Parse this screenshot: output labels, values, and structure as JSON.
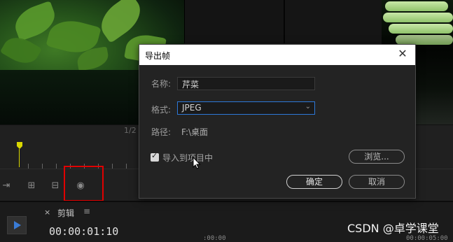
{
  "dialog": {
    "title": "导出帧",
    "name_label": "名称:",
    "name_value": "芹菜",
    "format_label": "格式:",
    "format_value": "JPEG",
    "path_label": "路径:",
    "path_value": "F:\\桌面",
    "import_label": "导入到项目中",
    "import_checked": true,
    "browse_label": "浏览...",
    "ok_label": "确定",
    "cancel_label": "取消"
  },
  "timeline": {
    "partial_label": "1/2",
    "sequence_name": "剪辑",
    "timecode": "00:00:01:10",
    "mini_timecode_1": ":00:00",
    "mini_timecode_2": "00:00:05:00"
  },
  "watermark": "CSDN @卓学课堂",
  "colors": {
    "accent": "#2d78d8",
    "highlight": "#e00000",
    "playhead": "#d9d700"
  }
}
